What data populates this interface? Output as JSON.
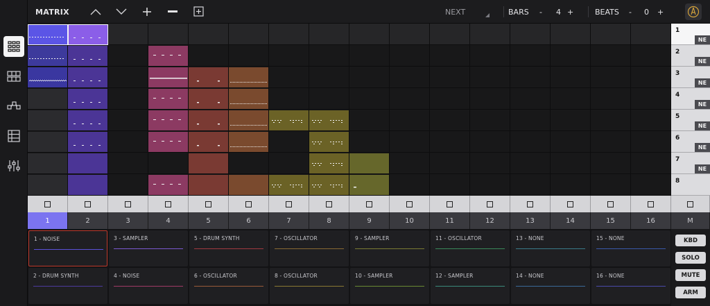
{
  "toolbar": {
    "title": "MATRIX",
    "next_label": "NEXT",
    "bars_label": "BARS",
    "bars_value": "4",
    "beats_label": "BEATS",
    "beats_value": "0",
    "minus": "-",
    "plus": "+"
  },
  "sidebar": {
    "items": [
      {
        "name": "matrix-view",
        "icon": "grid-icon",
        "active": true
      },
      {
        "name": "arrangement-view",
        "icon": "pattern-grid-icon",
        "active": false
      },
      {
        "name": "routing-view",
        "icon": "routing-icon",
        "active": false
      },
      {
        "name": "list-view",
        "icon": "list-icon",
        "active": false
      },
      {
        "name": "mixer-view",
        "icon": "sliders-icon",
        "active": false
      }
    ]
  },
  "colors": {
    "noise": "#5b50d8",
    "drum_synth": "#4d3a9e",
    "sampler": "#8c3a5f",
    "drum_synth2": "#7a3a33",
    "oscillator_brown": "#7a4a2e",
    "oscillator_olive": "#6b6226",
    "selected_track": "#7b74f0"
  },
  "matrix": {
    "columns": 16,
    "rows": 8,
    "clips": [
      {
        "col": 0,
        "row": 0,
        "color": "#5b55e6",
        "pattern": "dash-long",
        "selected": true
      },
      {
        "col": 0,
        "row": 1,
        "color": "#3d3a9c",
        "pattern": "dash-long"
      },
      {
        "col": 0,
        "row": 2,
        "color": "#3a37a0",
        "pattern": "wave"
      },
      {
        "col": 0,
        "row": 3,
        "color": "#2b2b2e",
        "pattern": "none"
      },
      {
        "col": 0,
        "row": 4,
        "color": "#2b2b2e",
        "pattern": "none"
      },
      {
        "col": 0,
        "row": 5,
        "color": "#2b2b2e",
        "pattern": "none"
      },
      {
        "col": 0,
        "row": 6,
        "color": "#2b2b2e",
        "pattern": "none"
      },
      {
        "col": 0,
        "row": 7,
        "color": "#2b2b2e",
        "pattern": "none"
      },
      {
        "col": 1,
        "row": 0,
        "color": "#8b5ee8",
        "pattern": "dash-sparse",
        "selected": true
      },
      {
        "col": 1,
        "row": 1,
        "color": "#4b3596",
        "pattern": "dash-sparse"
      },
      {
        "col": 1,
        "row": 2,
        "color": "#4b3596",
        "pattern": "dash-sparse"
      },
      {
        "col": 1,
        "row": 3,
        "color": "#4b3596",
        "pattern": "dash-sparse"
      },
      {
        "col": 1,
        "row": 4,
        "color": "#4b3596",
        "pattern": "dash-sparse"
      },
      {
        "col": 1,
        "row": 5,
        "color": "#4b3596",
        "pattern": "dash-sparse"
      },
      {
        "col": 1,
        "row": 6,
        "color": "#4b3596",
        "pattern": "none"
      },
      {
        "col": 1,
        "row": 7,
        "color": "#4b3596",
        "pattern": "none"
      },
      {
        "col": 3,
        "row": 1,
        "color": "#8c3a62",
        "pattern": "dash-med"
      },
      {
        "col": 3,
        "row": 2,
        "color": "#8c3a62",
        "pattern": "line"
      },
      {
        "col": 3,
        "row": 3,
        "color": "#8c3a62",
        "pattern": "dash-med"
      },
      {
        "col": 3,
        "row": 4,
        "color": "#8c3a62",
        "pattern": "dash-med"
      },
      {
        "col": 3,
        "row": 5,
        "color": "#8c3a62",
        "pattern": "dash-med"
      },
      {
        "col": 3,
        "row": 7,
        "color": "#8c3a62",
        "pattern": "dash-med"
      },
      {
        "col": 4,
        "row": 2,
        "color": "#7a3a33",
        "pattern": "dash-two"
      },
      {
        "col": 4,
        "row": 3,
        "color": "#7a3a33",
        "pattern": "dash-two"
      },
      {
        "col": 4,
        "row": 4,
        "color": "#7a3a33",
        "pattern": "dash-two"
      },
      {
        "col": 4,
        "row": 5,
        "color": "#7a3a33",
        "pattern": "dash-two"
      },
      {
        "col": 4,
        "row": 6,
        "color": "#7a3a33",
        "pattern": "none"
      },
      {
        "col": 4,
        "row": 7,
        "color": "#7a3a33",
        "pattern": "none"
      },
      {
        "col": 5,
        "row": 2,
        "color": "#7a4a2e",
        "pattern": "dots"
      },
      {
        "col": 5,
        "row": 3,
        "color": "#7a4a2e",
        "pattern": "dots"
      },
      {
        "col": 5,
        "row": 4,
        "color": "#7a4a2e",
        "pattern": "dots"
      },
      {
        "col": 5,
        "row": 5,
        "color": "#7a4a2e",
        "pattern": "dots"
      },
      {
        "col": 5,
        "row": 7,
        "color": "#7a4a2e",
        "pattern": "none"
      },
      {
        "col": 6,
        "row": 4,
        "color": "#6b6226",
        "pattern": "notes"
      },
      {
        "col": 6,
        "row": 7,
        "color": "#6b6226",
        "pattern": "notes"
      },
      {
        "col": 7,
        "row": 4,
        "color": "#6b6226",
        "pattern": "notes"
      },
      {
        "col": 7,
        "row": 5,
        "color": "#6b6226",
        "pattern": "notes"
      },
      {
        "col": 7,
        "row": 6,
        "color": "#6b6226",
        "pattern": "notes"
      },
      {
        "col": 7,
        "row": 7,
        "color": "#6b6226",
        "pattern": "notes"
      },
      {
        "col": 8,
        "row": 6,
        "color": "#66672b",
        "pattern": "none"
      },
      {
        "col": 8,
        "row": 7,
        "color": "#66672b",
        "pattern": "dash-one"
      }
    ]
  },
  "scenes": [
    {
      "num": "1",
      "tag": "NE"
    },
    {
      "num": "2",
      "tag": "NE"
    },
    {
      "num": "3",
      "tag": "NE"
    },
    {
      "num": "4",
      "tag": "NE"
    },
    {
      "num": "5",
      "tag": "NE"
    },
    {
      "num": "6",
      "tag": "NE"
    },
    {
      "num": "7",
      "tag": "NE"
    },
    {
      "num": "8",
      "tag": ""
    }
  ],
  "tracks": [
    "1",
    "2",
    "3",
    "4",
    "5",
    "6",
    "7",
    "8",
    "9",
    "10",
    "11",
    "12",
    "13",
    "14",
    "15",
    "16"
  ],
  "master_label": "M",
  "devices": [
    {
      "label": "1 - NOISE",
      "line": "#5b50d8",
      "selected": true
    },
    {
      "label": "2 - DRUM SYNTH",
      "line": "#4d3a9e"
    },
    {
      "label": "3 - SAMPLER",
      "line": "#7a5ad0"
    },
    {
      "label": "4 - NOISE",
      "line": "#a03a66"
    },
    {
      "label": "5 - DRUM SYNTH",
      "line": "#a03a40"
    },
    {
      "label": "6 - OSCILLATOR",
      "line": "#9a5a3a"
    },
    {
      "label": "7 - OSCILLATOR",
      "line": "#8a6a33"
    },
    {
      "label": "8 - OSCILLATOR",
      "line": "#8a7a33"
    },
    {
      "label": "9 - SAMPLER",
      "line": "#7a7a33"
    },
    {
      "label": "10 - SAMPLER",
      "line": "#6a8a33"
    },
    {
      "label": "11 - OSCILLATOR",
      "line": "#3a8a5a"
    },
    {
      "label": "12 - SAMPLER",
      "line": "#3a8a7a"
    },
    {
      "label": "13 - NONE",
      "line": "#3a7a8a"
    },
    {
      "label": "14 - NONE",
      "line": "#3a6a9a"
    },
    {
      "label": "15 - NONE",
      "line": "#3a5aaa"
    },
    {
      "label": "16 - NONE",
      "line": "#4a4aaa"
    }
  ],
  "actions": [
    "KBD",
    "SOLO",
    "MUTE",
    "ARM"
  ]
}
